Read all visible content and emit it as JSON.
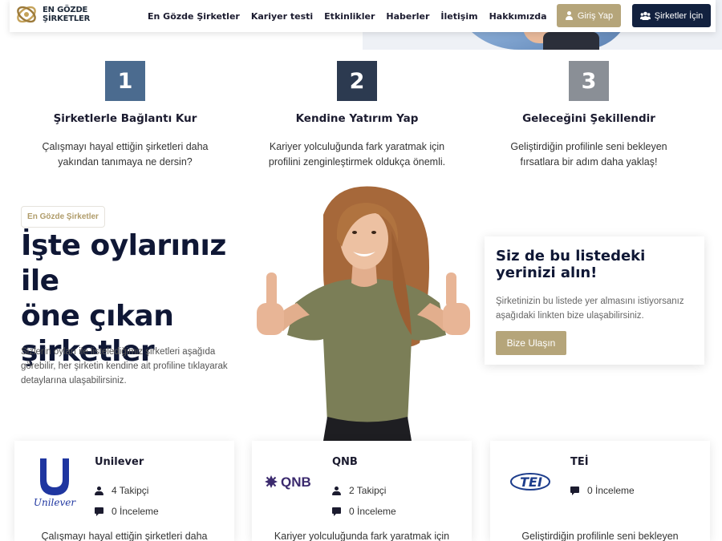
{
  "header": {
    "logo_line1": "EN GÖZDE",
    "logo_line2": "ŞİRKETLER",
    "nav": [
      "En Gözde Şirketler",
      "Kariyer testi",
      "Etkinlikler",
      "Haberler",
      "İletişim",
      "Hakkımızda"
    ],
    "login_label": "Giriş Yap",
    "companies_label": "Şirketler İçin"
  },
  "steps": [
    {
      "number": "1",
      "title": "Şirketlerle Bağlantı Kur",
      "desc_line1": "Çalışmayı hayal ettiğin şirketleri daha",
      "desc_line2": "yakından tanımaya ne dersin?",
      "color": "#4b6b8f"
    },
    {
      "number": "2",
      "title": "Kendine Yatırım Yap",
      "desc_line1": "Kariyer yolculuğunda fark yaratmak için",
      "desc_line2": "profilini zenginleştirmek oldukça önemli.",
      "color": "#2c3a50"
    },
    {
      "number": "3",
      "title": "Geleceğini Şekillendir",
      "desc_line1": "Geliştirdiğin profilinle seni bekleyen",
      "desc_line2": "fırsatlara bir adım daha yaklaş!",
      "color": "#8a8f96"
    }
  ],
  "section": {
    "badge": "En Gözde Şirketler",
    "title_line1": "İşte oylarınız ile",
    "title_line2": "öne çıkan",
    "title_line3": "şirketler",
    "lead_line1": "Sizlerin oyları ile listelediğimiz şirketleri aşağıda",
    "lead_line2": "görebilir, her şirketin kendine ait profiline tıklayarak",
    "lead_line3": "detaylarına ulaşabilirsiniz."
  },
  "cta": {
    "title_line1": "Siz de bu listedeki",
    "title_line2": "yerinizi alın!",
    "text_line1": "Şirketinizin bu listede yer almasını istiyorsanız",
    "text_line2": "aşağıdaki linkten bize ulaşabilirsiniz.",
    "button": "Bize Ulaşın"
  },
  "companies": [
    {
      "name": "Unilever",
      "logo_text": "Unilever",
      "followers": "4 Takipçi",
      "reviews": "0 İnceleme",
      "desc": "Çalışmayı hayal ettiğin şirketleri daha"
    },
    {
      "name": "QNB",
      "logo_text": "QNB",
      "followers": "2 Takipçi",
      "reviews": "0 İnceleme",
      "desc": "Kariyer yolculuğunda fark yaratmak için"
    },
    {
      "name": "TEİ",
      "logo_text": "TEI",
      "reviews": "0 İnceleme",
      "desc": "Geliştirdiğin profilinle seni bekleyen"
    }
  ],
  "colors": {
    "gold": "#b5a57a",
    "navy": "#12213f",
    "title": "#0f1735"
  }
}
